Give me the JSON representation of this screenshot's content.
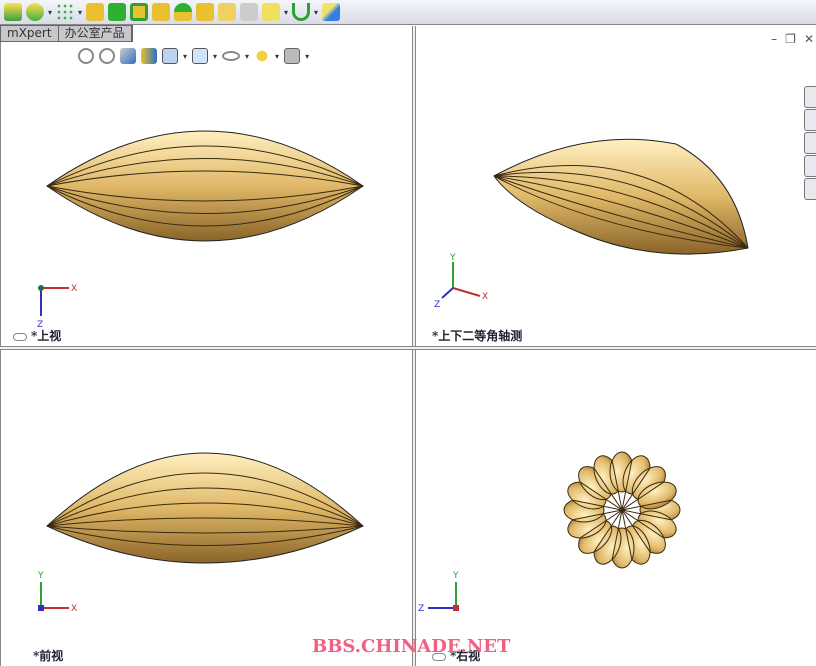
{
  "toolbar": {
    "icons": [
      "extrude-boss-icon",
      "revolve-icon",
      "pattern-icon",
      "rib-icon",
      "draft-icon",
      "shell-icon",
      "wrap-icon",
      "dome-icon",
      "split-icon",
      "reference-icon",
      "curves-icon",
      "sketch-point-icon",
      "spline-icon",
      "measure-icon"
    ]
  },
  "tabs": [
    {
      "label": "mXpert"
    },
    {
      "label": "办公室产品"
    }
  ],
  "view_toolbar": {
    "icons": [
      "zoom-to-fit-icon",
      "zoom-area-icon",
      "previous-view-icon",
      "section-view-icon",
      "view-orientation-icon",
      "display-style-icon",
      "hide-show-icon",
      "lights-icon",
      "scene-icon"
    ]
  },
  "window_controls": {
    "minimize": "–",
    "restore": "❐",
    "close": "✕"
  },
  "viewports": [
    {
      "label": "*上视",
      "axes": [
        "X",
        "Z"
      ]
    },
    {
      "label": "*上下二等角轴测",
      "axes": [
        "Y",
        "X",
        "Z"
      ]
    },
    {
      "label": "*前视",
      "axes": [
        "Y",
        "X"
      ]
    },
    {
      "label": "*右视",
      "axes": [
        "Y",
        "Z"
      ]
    }
  ],
  "watermark": "BBS.CHINADE.NET",
  "colors": {
    "model": "#e8c878",
    "model_dark": "#a07830",
    "axis_x": "#c03030",
    "axis_y": "#30a030",
    "axis_z": "#3030c0"
  }
}
